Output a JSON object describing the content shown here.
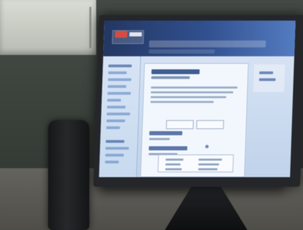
{
  "scene": {
    "objects": {
      "monitor": "monitor",
      "speaker": "speaker",
      "cabinet": "cabinet",
      "desk": "desk"
    }
  },
  "screen": {
    "header": {
      "logo_icon": "logo-icon"
    },
    "sidebar": {
      "items": [
        "nav-item-1",
        "nav-item-2",
        "nav-item-3",
        "nav-item-4",
        "nav-item-5",
        "nav-item-6",
        "nav-item-7",
        "nav-item-8",
        "nav-item-9",
        "nav-item-10",
        "nav-item-11",
        "nav-item-12",
        "nav-item-13",
        "nav-item-14"
      ]
    },
    "main": {
      "icons": {
        "radio": "radio-icon"
      }
    }
  },
  "colors": {
    "header": "#2c4c8d",
    "screen": "#dce7f6",
    "panel": "#f2f7fd",
    "accent": "#d3473e"
  }
}
